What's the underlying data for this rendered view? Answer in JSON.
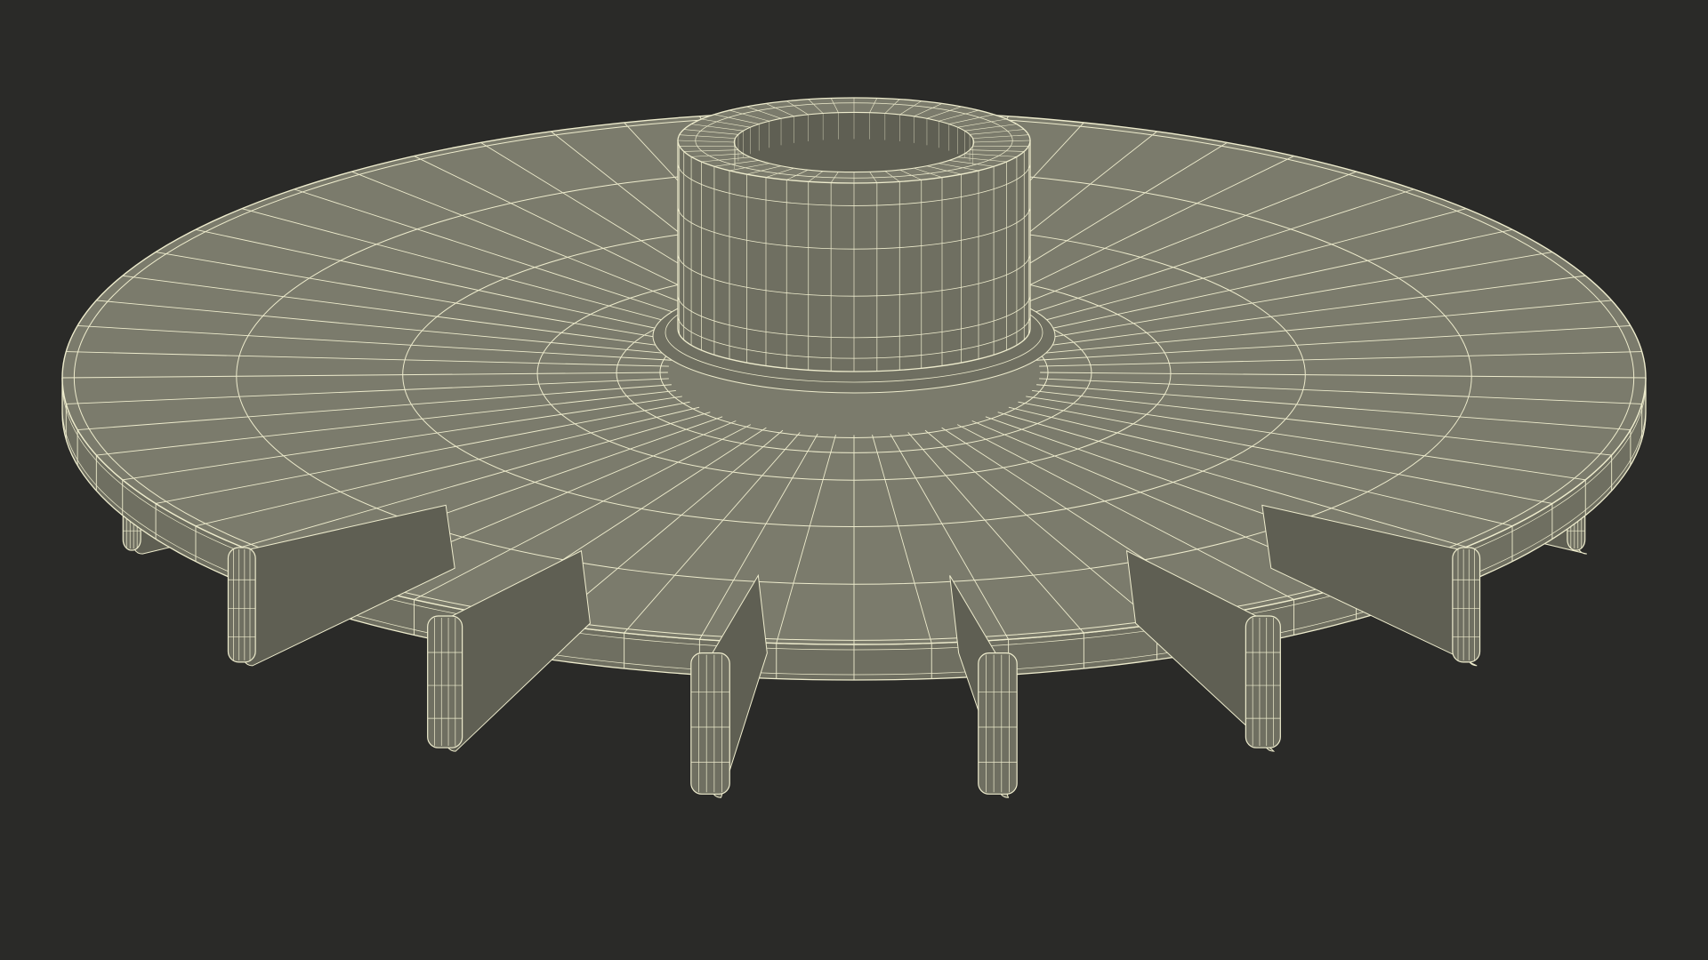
{
  "scene": {
    "background_color": "#2a2a28",
    "model_fill_top": "#7b7b6c",
    "model_fill_side": "#6f6f61",
    "model_fill_dark": "#5f5f53",
    "wire_color": "#eeeccd",
    "render_style": "wireframe-over-shaded",
    "subject": "impeller-disc-with-hub-and-radial-fins",
    "fin_count": 16,
    "radial_segments": 64
  }
}
